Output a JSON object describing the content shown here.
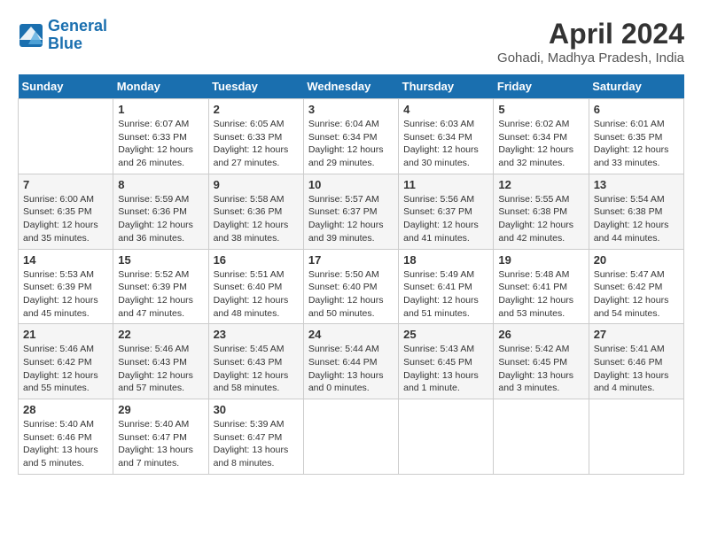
{
  "header": {
    "logo_line1": "General",
    "logo_line2": "Blue",
    "month_title": "April 2024",
    "location": "Gohadi, Madhya Pradesh, India"
  },
  "days_of_week": [
    "Sunday",
    "Monday",
    "Tuesday",
    "Wednesday",
    "Thursday",
    "Friday",
    "Saturday"
  ],
  "weeks": [
    [
      {
        "day": "",
        "info": ""
      },
      {
        "day": "1",
        "info": "Sunrise: 6:07 AM\nSunset: 6:33 PM\nDaylight: 12 hours\nand 26 minutes."
      },
      {
        "day": "2",
        "info": "Sunrise: 6:05 AM\nSunset: 6:33 PM\nDaylight: 12 hours\nand 27 minutes."
      },
      {
        "day": "3",
        "info": "Sunrise: 6:04 AM\nSunset: 6:34 PM\nDaylight: 12 hours\nand 29 minutes."
      },
      {
        "day": "4",
        "info": "Sunrise: 6:03 AM\nSunset: 6:34 PM\nDaylight: 12 hours\nand 30 minutes."
      },
      {
        "day": "5",
        "info": "Sunrise: 6:02 AM\nSunset: 6:34 PM\nDaylight: 12 hours\nand 32 minutes."
      },
      {
        "day": "6",
        "info": "Sunrise: 6:01 AM\nSunset: 6:35 PM\nDaylight: 12 hours\nand 33 minutes."
      }
    ],
    [
      {
        "day": "7",
        "info": "Sunrise: 6:00 AM\nSunset: 6:35 PM\nDaylight: 12 hours\nand 35 minutes."
      },
      {
        "day": "8",
        "info": "Sunrise: 5:59 AM\nSunset: 6:36 PM\nDaylight: 12 hours\nand 36 minutes."
      },
      {
        "day": "9",
        "info": "Sunrise: 5:58 AM\nSunset: 6:36 PM\nDaylight: 12 hours\nand 38 minutes."
      },
      {
        "day": "10",
        "info": "Sunrise: 5:57 AM\nSunset: 6:37 PM\nDaylight: 12 hours\nand 39 minutes."
      },
      {
        "day": "11",
        "info": "Sunrise: 5:56 AM\nSunset: 6:37 PM\nDaylight: 12 hours\nand 41 minutes."
      },
      {
        "day": "12",
        "info": "Sunrise: 5:55 AM\nSunset: 6:38 PM\nDaylight: 12 hours\nand 42 minutes."
      },
      {
        "day": "13",
        "info": "Sunrise: 5:54 AM\nSunset: 6:38 PM\nDaylight: 12 hours\nand 44 minutes."
      }
    ],
    [
      {
        "day": "14",
        "info": "Sunrise: 5:53 AM\nSunset: 6:39 PM\nDaylight: 12 hours\nand 45 minutes."
      },
      {
        "day": "15",
        "info": "Sunrise: 5:52 AM\nSunset: 6:39 PM\nDaylight: 12 hours\nand 47 minutes."
      },
      {
        "day": "16",
        "info": "Sunrise: 5:51 AM\nSunset: 6:40 PM\nDaylight: 12 hours\nand 48 minutes."
      },
      {
        "day": "17",
        "info": "Sunrise: 5:50 AM\nSunset: 6:40 PM\nDaylight: 12 hours\nand 50 minutes."
      },
      {
        "day": "18",
        "info": "Sunrise: 5:49 AM\nSunset: 6:41 PM\nDaylight: 12 hours\nand 51 minutes."
      },
      {
        "day": "19",
        "info": "Sunrise: 5:48 AM\nSunset: 6:41 PM\nDaylight: 12 hours\nand 53 minutes."
      },
      {
        "day": "20",
        "info": "Sunrise: 5:47 AM\nSunset: 6:42 PM\nDaylight: 12 hours\nand 54 minutes."
      }
    ],
    [
      {
        "day": "21",
        "info": "Sunrise: 5:46 AM\nSunset: 6:42 PM\nDaylight: 12 hours\nand 55 minutes."
      },
      {
        "day": "22",
        "info": "Sunrise: 5:46 AM\nSunset: 6:43 PM\nDaylight: 12 hours\nand 57 minutes."
      },
      {
        "day": "23",
        "info": "Sunrise: 5:45 AM\nSunset: 6:43 PM\nDaylight: 12 hours\nand 58 minutes."
      },
      {
        "day": "24",
        "info": "Sunrise: 5:44 AM\nSunset: 6:44 PM\nDaylight: 13 hours\nand 0 minutes."
      },
      {
        "day": "25",
        "info": "Sunrise: 5:43 AM\nSunset: 6:45 PM\nDaylight: 13 hours\nand 1 minute."
      },
      {
        "day": "26",
        "info": "Sunrise: 5:42 AM\nSunset: 6:45 PM\nDaylight: 13 hours\nand 3 minutes."
      },
      {
        "day": "27",
        "info": "Sunrise: 5:41 AM\nSunset: 6:46 PM\nDaylight: 13 hours\nand 4 minutes."
      }
    ],
    [
      {
        "day": "28",
        "info": "Sunrise: 5:40 AM\nSunset: 6:46 PM\nDaylight: 13 hours\nand 5 minutes."
      },
      {
        "day": "29",
        "info": "Sunrise: 5:40 AM\nSunset: 6:47 PM\nDaylight: 13 hours\nand 7 minutes."
      },
      {
        "day": "30",
        "info": "Sunrise: 5:39 AM\nSunset: 6:47 PM\nDaylight: 13 hours\nand 8 minutes."
      },
      {
        "day": "",
        "info": ""
      },
      {
        "day": "",
        "info": ""
      },
      {
        "day": "",
        "info": ""
      },
      {
        "day": "",
        "info": ""
      }
    ]
  ]
}
